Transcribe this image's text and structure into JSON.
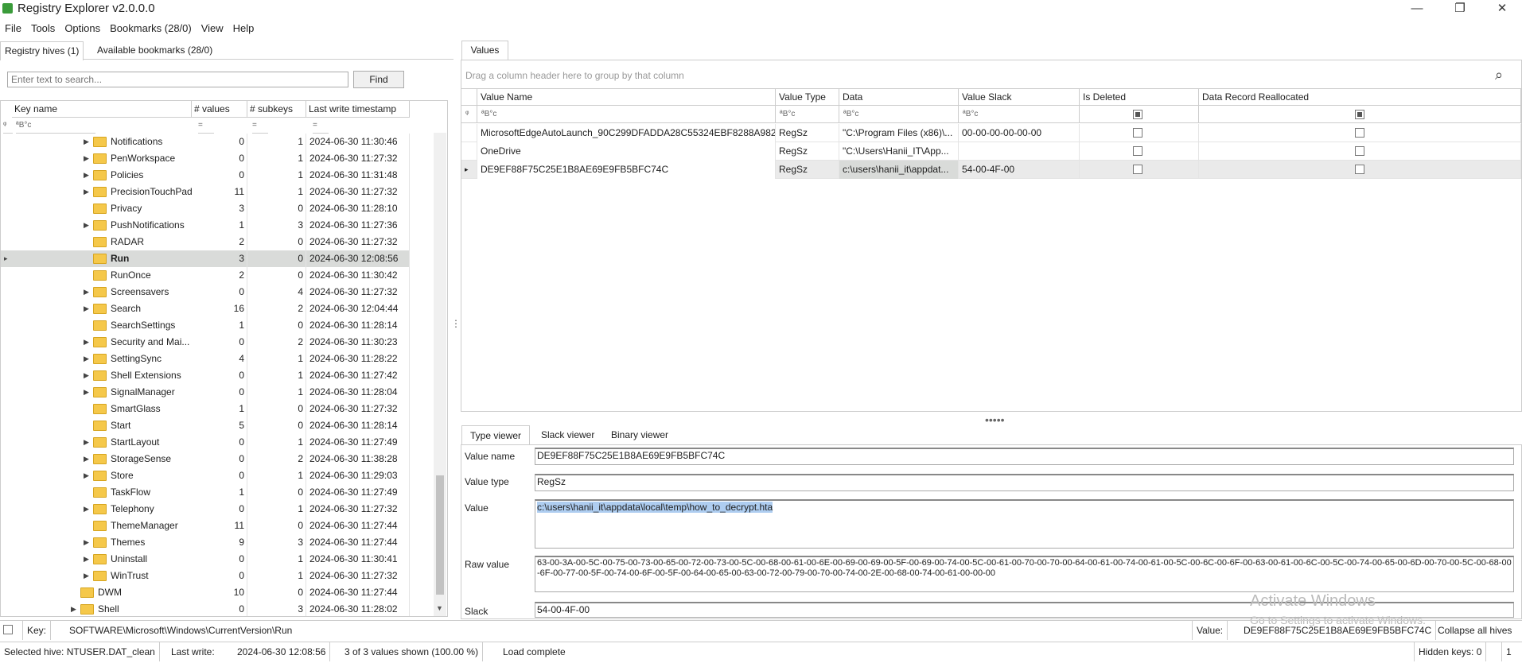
{
  "window": {
    "title": "Registry Explorer v2.0.0.0",
    "minimize": "—",
    "restore": "❐",
    "close": "✕"
  },
  "menu": [
    "File",
    "Tools",
    "Options",
    "Bookmarks (28/0)",
    "View",
    "Help"
  ],
  "left": {
    "tabs": [
      "Registry hives (1)",
      "Available bookmarks (28/0)"
    ],
    "search_placeholder": "Enter text to search...",
    "find_label": "Find",
    "columns": [
      "Key name",
      "# values",
      "# subkeys",
      "Last write timestamp"
    ],
    "filter_text": "ªB°c",
    "filter_eq": "=",
    "rows": [
      {
        "name": "Notifications",
        "values": "0",
        "subkeys": "1",
        "ts": "2024-06-30 11:30:46",
        "exp": true
      },
      {
        "name": "PenWorkspace",
        "values": "0",
        "subkeys": "1",
        "ts": "2024-06-30 11:27:32",
        "exp": true
      },
      {
        "name": "Policies",
        "values": "0",
        "subkeys": "1",
        "ts": "2024-06-30 11:31:48",
        "exp": true
      },
      {
        "name": "PrecisionTouchPad",
        "values": "11",
        "subkeys": "1",
        "ts": "2024-06-30 11:27:32",
        "exp": true
      },
      {
        "name": "Privacy",
        "values": "3",
        "subkeys": "0",
        "ts": "2024-06-30 11:28:10",
        "exp": false
      },
      {
        "name": "PushNotifications",
        "values": "1",
        "subkeys": "3",
        "ts": "2024-06-30 11:27:36",
        "exp": true
      },
      {
        "name": "RADAR",
        "values": "2",
        "subkeys": "0",
        "ts": "2024-06-30 11:27:32",
        "exp": false
      },
      {
        "name": "Run",
        "values": "3",
        "subkeys": "0",
        "ts": "2024-06-30 12:08:56",
        "exp": false,
        "sel": true
      },
      {
        "name": "RunOnce",
        "values": "2",
        "subkeys": "0",
        "ts": "2024-06-30 11:30:42",
        "exp": false
      },
      {
        "name": "Screensavers",
        "values": "0",
        "subkeys": "4",
        "ts": "2024-06-30 11:27:32",
        "exp": true
      },
      {
        "name": "Search",
        "values": "16",
        "subkeys": "2",
        "ts": "2024-06-30 12:04:44",
        "exp": true
      },
      {
        "name": "SearchSettings",
        "values": "1",
        "subkeys": "0",
        "ts": "2024-06-30 11:28:14",
        "exp": false
      },
      {
        "name": "Security and Mai...",
        "values": "0",
        "subkeys": "2",
        "ts": "2024-06-30 11:30:23",
        "exp": true
      },
      {
        "name": "SettingSync",
        "values": "4",
        "subkeys": "1",
        "ts": "2024-06-30 11:28:22",
        "exp": true
      },
      {
        "name": "Shell Extensions",
        "values": "0",
        "subkeys": "1",
        "ts": "2024-06-30 11:27:42",
        "exp": true
      },
      {
        "name": "SignalManager",
        "values": "0",
        "subkeys": "1",
        "ts": "2024-06-30 11:28:04",
        "exp": true
      },
      {
        "name": "SmartGlass",
        "values": "1",
        "subkeys": "0",
        "ts": "2024-06-30 11:27:32",
        "exp": false
      },
      {
        "name": "Start",
        "values": "5",
        "subkeys": "0",
        "ts": "2024-06-30 11:28:14",
        "exp": false
      },
      {
        "name": "StartLayout",
        "values": "0",
        "subkeys": "1",
        "ts": "2024-06-30 11:27:49",
        "exp": true
      },
      {
        "name": "StorageSense",
        "values": "0",
        "subkeys": "2",
        "ts": "2024-06-30 11:38:28",
        "exp": true
      },
      {
        "name": "Store",
        "values": "0",
        "subkeys": "1",
        "ts": "2024-06-30 11:29:03",
        "exp": true
      },
      {
        "name": "TaskFlow",
        "values": "1",
        "subkeys": "0",
        "ts": "2024-06-30 11:27:49",
        "exp": false
      },
      {
        "name": "Telephony",
        "values": "0",
        "subkeys": "1",
        "ts": "2024-06-30 11:27:32",
        "exp": true
      },
      {
        "name": "ThemeManager",
        "values": "11",
        "subkeys": "0",
        "ts": "2024-06-30 11:27:44",
        "exp": false
      },
      {
        "name": "Themes",
        "values": "9",
        "subkeys": "3",
        "ts": "2024-06-30 11:27:44",
        "exp": true
      },
      {
        "name": "Uninstall",
        "values": "0",
        "subkeys": "1",
        "ts": "2024-06-30 11:30:41",
        "exp": true
      },
      {
        "name": "WinTrust",
        "values": "0",
        "subkeys": "1",
        "ts": "2024-06-30 11:27:32",
        "exp": true
      },
      {
        "name": "DWM",
        "values": "10",
        "subkeys": "0",
        "ts": "2024-06-30 11:27:44",
        "exp": false,
        "lvl": 1
      },
      {
        "name": "Shell",
        "values": "0",
        "subkeys": "3",
        "ts": "2024-06-30 11:28:02",
        "exp": true,
        "lvl": 1
      }
    ]
  },
  "values": {
    "tab": "Values",
    "group_hint": "Drag a column header here to group by that column",
    "columns": [
      "Value Name",
      "Value Type",
      "Data",
      "Value Slack",
      "Is Deleted",
      "Data Record Reallocated"
    ],
    "filter_text": "ªB°c",
    "rows": [
      {
        "name": "MicrosoftEdgeAutoLaunch_90C299DFADDA28C55324EBF8288A9825",
        "type": "RegSz",
        "data": "\"C:\\Program Files (x86)\\...",
        "slack": "00-00-00-00-00-00"
      },
      {
        "name": "OneDrive",
        "type": "RegSz",
        "data": "\"C:\\Users\\Hanii_IT\\App...",
        "slack": ""
      },
      {
        "name": "DE9EF88F75C25E1B8AE69E9FB5BFC74C",
        "type": "RegSz",
        "data": "c:\\users\\hanii_it\\appdat...",
        "slack": "54-00-4F-00",
        "sel": true
      }
    ]
  },
  "viewer": {
    "tabs": [
      "Type viewer",
      "Slack viewer",
      "Binary viewer"
    ],
    "value_name_label": "Value name",
    "value_name": "DE9EF88F75C25E1B8AE69E9FB5BFC74C",
    "value_type_label": "Value type",
    "value_type": "RegSz",
    "value_label": "Value",
    "value": "c:\\users\\hanii_it\\appdata\\local\\temp\\how_to_decrypt.hta",
    "raw_label": "Raw value",
    "raw": "63-00-3A-00-5C-00-75-00-73-00-65-00-72-00-73-00-5C-00-68-00-61-00-6E-00-69-00-69-00-5F-00-69-00-74-00-5C-00-61-00-70-00-70-00-64-00-61-00-74-00-61-00-5C-00-6C-00-6F-00-63-00-61-00-6C-00-5C-00-74-00-65-00-6D-00-70-00-5C-00-68-00-6F-00-77-00-5F-00-74-00-6F-00-5F-00-64-00-65-00-63-00-72-00-79-00-70-00-74-00-2E-00-68-00-74-00-61-00-00-00",
    "slack_label": "Slack",
    "slack": "54-00-4F-00"
  },
  "watermark": {
    "line1": "Activate Windows",
    "line2": "Go to Settings to activate Windows."
  },
  "keybar": {
    "key_label": "Key:",
    "key_path": "SOFTWARE\\Microsoft\\Windows\\CurrentVersion\\Run",
    "value_label": "Value:",
    "value": "DE9EF88F75C25E1B8AE69E9FB5BFC74C",
    "collapse": "Collapse all hives"
  },
  "status": {
    "hive": "Selected hive: NTUSER.DAT_clean",
    "last_write_label": "Last write:",
    "last_write": "2024-06-30 12:08:56",
    "shown": "3 of 3 values shown (100.00 %)",
    "load": "Load complete",
    "hidden": "Hidden keys: 0",
    "count": "1"
  }
}
